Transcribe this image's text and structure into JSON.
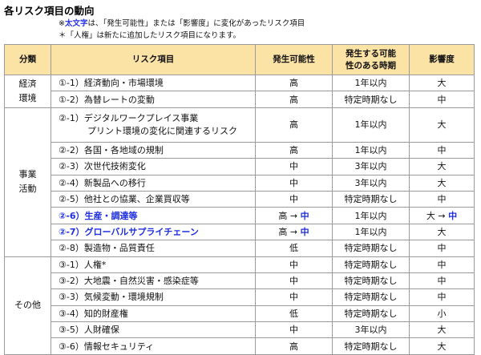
{
  "title": "各リスク項目の動向",
  "notes": {
    "note1_prefix": "※",
    "note1_bold": "太文字",
    "note1_rest": "は、「発生可能性」または「影響度」に変化があったリスク項目",
    "note2": "＊「人権」は新たに追加したリスク項目になります。"
  },
  "headers": {
    "category": "分類",
    "risk": "リスク項目",
    "probability": "発生可能性",
    "timing": "発生する可能性のある時期",
    "impact": "影響度"
  },
  "categories": {
    "economy": "経済環境",
    "business": "事業活動",
    "other": "その他"
  },
  "rows": [
    {
      "risk": "①-1）経済動向・市場環境",
      "prob": "高",
      "timing": "1年以内",
      "impact": "大"
    },
    {
      "risk": "①-2）為替レートの変動",
      "prob": "高",
      "timing": "特定時期なし",
      "impact": "中"
    },
    {
      "risk": "②-1）デジタルワークプレイス事業",
      "risk2": "プリント環境の変化に関連するリスク",
      "prob": "高",
      "timing": "1年以内",
      "impact": "大"
    },
    {
      "risk": "②-2）各国・各地域の規制",
      "prob": "高",
      "timing": "1年以内",
      "impact": "中"
    },
    {
      "risk": "②-3）次世代技術変化",
      "prob": "中",
      "timing": "3年以内",
      "impact": "大"
    },
    {
      "risk": "②-4）新製品への移行",
      "prob": "中",
      "timing": "3年以内",
      "impact": "大"
    },
    {
      "risk": "②-5）他社との協業、企業買収等",
      "prob": "中",
      "timing": "特定時期なし",
      "impact": "中"
    },
    {
      "risk": "②-6）生産・調達等",
      "prob_from": "高",
      "arrow": "→",
      "prob_to": "中",
      "timing": "1年以内",
      "impact_from": "大",
      "impact_to": "中"
    },
    {
      "risk": "②-7）グローバルサプライチェーン",
      "prob_from": "高",
      "arrow": "→",
      "prob_to": "中",
      "timing": "1年以内",
      "impact": "大"
    },
    {
      "risk": "②-8）製造物・品質責任",
      "prob": "低",
      "timing": "特定時期なし",
      "impact": "中"
    },
    {
      "risk": "③-1）人権*",
      "prob": "中",
      "timing": "特定時期なし",
      "impact": "中"
    },
    {
      "risk": "③-2）大地震・自然災害・感染症等",
      "prob": "中",
      "timing": "特定時期なし",
      "impact": "中"
    },
    {
      "risk": "③-3）気候変動・環境規制",
      "prob": "中",
      "timing": "特定時期なし",
      "impact": "中"
    },
    {
      "risk": "③-4）知的財産権",
      "prob": "低",
      "timing": "特定時期なし",
      "impact": "小"
    },
    {
      "risk": "③-5）人財確保",
      "prob": "中",
      "timing": "3年以内",
      "impact": "大"
    },
    {
      "risk": "③-6）情報セキュリティ",
      "prob": "高",
      "timing": "特定時期なし",
      "impact": "大"
    }
  ]
}
